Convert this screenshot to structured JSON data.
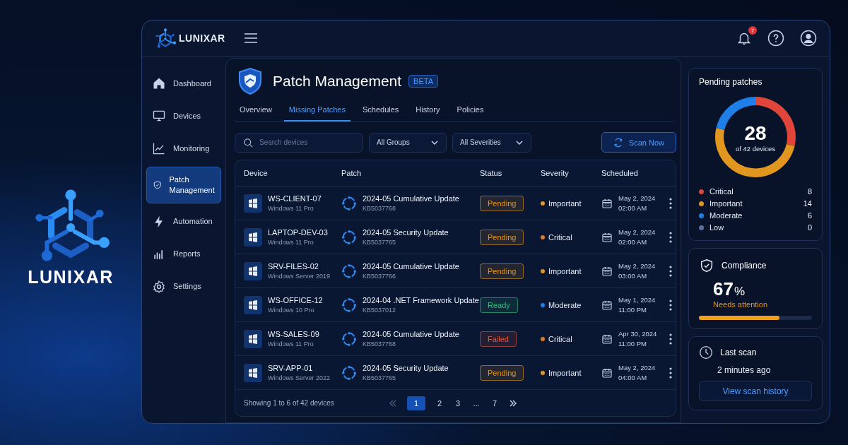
{
  "brand": {
    "name": "LUNIXAR"
  },
  "header": {
    "logo_text": "LUNIXAR",
    "notification_count": "7"
  },
  "sidebar": {
    "items": [
      {
        "label": "Dashboard",
        "selected": false
      },
      {
        "label": "Devices",
        "selected": false
      },
      {
        "label": "Monitoring",
        "selected": false
      },
      {
        "label": "Patch Management",
        "selected": true
      },
      {
        "label": "Automation",
        "selected": false
      },
      {
        "label": "Reports",
        "selected": false
      },
      {
        "label": "Settings",
        "selected": false
      }
    ]
  },
  "page": {
    "title": "Patch Management",
    "badge": "BETA"
  },
  "tabs": [
    {
      "label": "Overview",
      "selected": false
    },
    {
      "label": "Missing Patches",
      "selected": true
    },
    {
      "label": "Schedules",
      "selected": false
    },
    {
      "label": "History",
      "selected": false
    },
    {
      "label": "Policies",
      "selected": false
    }
  ],
  "filters": {
    "search": {
      "placeholder": "Search devices"
    },
    "group": "All Groups",
    "severity": "All Severities",
    "scan_button": "Scan Now"
  },
  "table": {
    "columns": [
      "Device",
      "Patch",
      "Status",
      "Severity",
      "Scheduled"
    ],
    "rows": [
      {
        "device": "WS-CLIENT-07",
        "os": "Windows 11 Pro",
        "patch": "2024-05 Cumulative Update",
        "kb": "KB5037768",
        "status": {
          "label": "Pending",
          "color": "#e0961f"
        },
        "severity": {
          "label": "Important",
          "color": "#e0961f"
        },
        "date": "May 2, 2024",
        "time": "02:00 AM"
      },
      {
        "device": "LAPTOP-DEV-03",
        "os": "Windows 11 Pro",
        "patch": "2024-05 Security Update",
        "kb": "KB5037765",
        "status": {
          "label": "Pending",
          "color": "#e0961f"
        },
        "severity": {
          "label": "Critical",
          "color": "#e07a2a"
        },
        "date": "May 2, 2024",
        "time": "02:00 AM"
      },
      {
        "device": "SRV-FILES-02",
        "os": "Windows Server 2019",
        "patch": "2024-05 Cumulative Update",
        "kb": "KB5037766",
        "status": {
          "label": "Pending",
          "color": "#e0961f"
        },
        "severity": {
          "label": "Important",
          "color": "#e0961f"
        },
        "date": "May 2, 2024",
        "time": "03:00 AM"
      },
      {
        "device": "WS-OFFICE-12",
        "os": "Windows 10 Pro",
        "patch": "2024-04 .NET Framework Update",
        "kb": "KB5037012",
        "status": {
          "label": "Ready",
          "color": "#2fbf7a"
        },
        "severity": {
          "label": "Moderate",
          "color": "#1e7fe8"
        },
        "date": "May 1, 2024",
        "time": "11:00 PM"
      },
      {
        "device": "WS-SALES-09",
        "os": "Windows 11 Pro",
        "patch": "2024-05 Cumulative Update",
        "kb": "KB5037768",
        "status": {
          "label": "Failed",
          "color": "#e0563a"
        },
        "severity": {
          "label": "Critical",
          "color": "#e07a2a"
        },
        "date": "Apr 30, 2024",
        "time": "11:00 PM"
      },
      {
        "device": "SRV-APP-01",
        "os": "Windows Server 2022",
        "patch": "2024-05 Security Update",
        "kb": "KB5037765",
        "status": {
          "label": "Pending",
          "color": "#e0961f"
        },
        "severity": {
          "label": "Important",
          "color": "#e0961f"
        },
        "date": "May 2, 2024",
        "time": "04:00 AM"
      }
    ],
    "summary": "Showing 1 to 6 of 42 devices",
    "pages": [
      {
        "label": "1",
        "selected": true
      },
      {
        "label": "2",
        "selected": false
      },
      {
        "label": "3",
        "selected": false
      },
      {
        "label": "...",
        "selected": false
      },
      {
        "label": "7",
        "selected": false
      }
    ]
  },
  "pending": {
    "total": "28",
    "subtitle": "of 42 devices",
    "chart_data": {
      "type": "donut",
      "title": "Pending patches",
      "categories": [
        "Critical",
        "Important",
        "Moderate",
        "Low"
      ],
      "values": [
        28.6,
        50,
        21.4,
        0
      ]
    },
    "legend": [
      {
        "count": "8",
        "color": "#e0453a"
      },
      {
        "count": "14",
        "color": "#e0961f"
      },
      {
        "count": "6",
        "color": "#1e7fe8"
      },
      {
        "count": "0",
        "color": "#5a6f9a"
      }
    ]
  },
  "compliance": {
    "title": "Compliance",
    "value": "67",
    "unit": "%",
    "status": "Needs attention",
    "level": 0.71
  },
  "last_scan": {
    "title": "Last scan",
    "value": "2 minutes ago",
    "button": "View scan history"
  }
}
